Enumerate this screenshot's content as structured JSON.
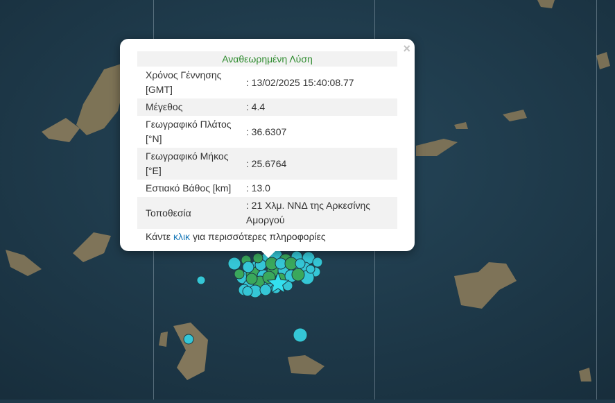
{
  "popup": {
    "header": "Αναθεωρημένη Λύση",
    "close_symbol": "×",
    "rows": [
      {
        "label": "Χρόνος Γέννησης [GMT]",
        "value": ": 13/02/2025 15:40:08.77"
      },
      {
        "label": "Μέγεθος",
        "value": ": 4.4"
      },
      {
        "label": "Γεωγραφικό Πλάτος [°N]",
        "value": ": 36.6307"
      },
      {
        "label": "Γεωγραφικό Μήκος [°E]",
        "value": ": 25.6764"
      },
      {
        "label": "Εστιακό Βάθος [km]",
        "value": ": 13.0"
      },
      {
        "label": "Τοποθεσία",
        "value": ": 21 Χλμ. ΝΝΔ της Αρκεσίνης Αμοργού"
      }
    ],
    "more_prefix": "Κάντε",
    "more_link": "κλικ",
    "more_suffix": "για περισσότερες πληροφορίες"
  },
  "map": {
    "sea_color": "#1f3a4a",
    "land_color": "#8a7a5c",
    "marker_cyan": "#35c6d6",
    "marker_green": "#3aa85c",
    "star_color": "#33e0f0",
    "star_icon": "star-icon"
  }
}
